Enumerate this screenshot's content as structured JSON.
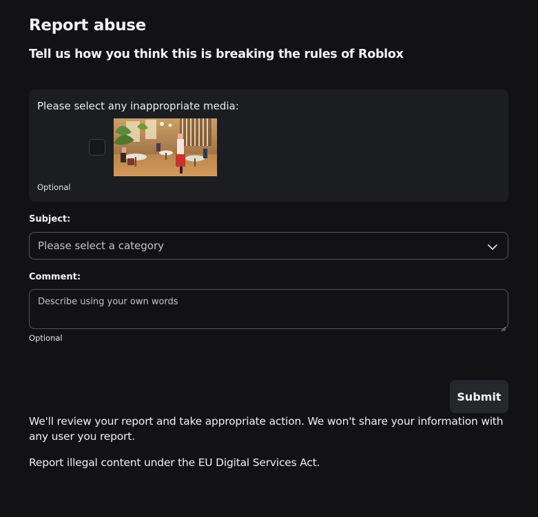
{
  "header": {
    "title": "Report abuse",
    "subtitle": "Tell us how you think this is breaking the rules of Roblox"
  },
  "media": {
    "label": "Please select any inappropriate media:",
    "checkbox_checked": false,
    "optional_label": "Optional"
  },
  "subject": {
    "label": "Subject:",
    "placeholder": "Please select a category",
    "icon": "chevron-down-icon"
  },
  "comment": {
    "label": "Comment:",
    "placeholder": "Describe using your own words",
    "optional_label": "Optional"
  },
  "actions": {
    "submit_label": "Submit"
  },
  "footer": {
    "notice": "We'll review your report and take appropriate action. We won't share your information with any user you report.",
    "dsa_link": "Report illegal content under the EU Digital Services Act."
  },
  "colors": {
    "background": "#121215",
    "card": "#1c1d21",
    "border": "#54555c",
    "button": "#26272d",
    "text": "#f2f2f3",
    "placeholder": "#c4c5cb"
  }
}
